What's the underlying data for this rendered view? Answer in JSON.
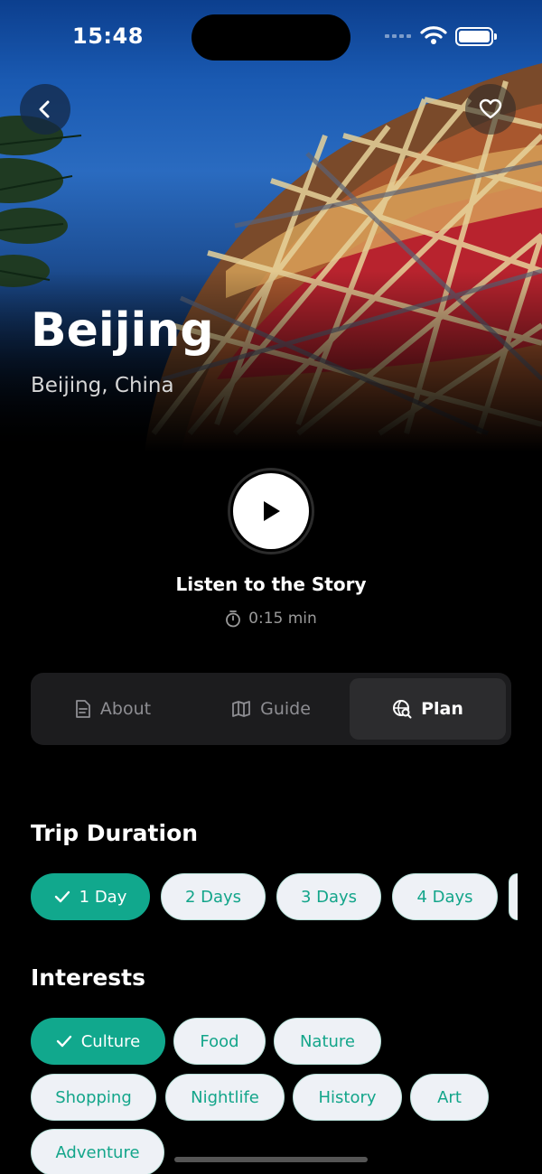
{
  "status_bar": {
    "time": "15:48"
  },
  "hero": {
    "title": "Beijing",
    "subtitle": "Beijing, China"
  },
  "player": {
    "label": "Listen to the Story",
    "duration": "0:15 min"
  },
  "tabs": [
    {
      "label": "About",
      "icon": "document-icon",
      "selected": false
    },
    {
      "label": "Guide",
      "icon": "map-icon",
      "selected": false
    },
    {
      "label": "Plan",
      "icon": "globe-search-icon",
      "selected": true
    }
  ],
  "trip_duration": {
    "title": "Trip Duration",
    "options": [
      {
        "label": "1 Day",
        "selected": true
      },
      {
        "label": "2 Days",
        "selected": false
      },
      {
        "label": "3 Days",
        "selected": false
      },
      {
        "label": "4 Days",
        "selected": false
      }
    ]
  },
  "interests": {
    "title": "Interests",
    "options": [
      {
        "label": "Culture",
        "selected": true
      },
      {
        "label": "Food",
        "selected": false
      },
      {
        "label": "Nature",
        "selected": false
      },
      {
        "label": "Shopping",
        "selected": false
      },
      {
        "label": "Nightlife",
        "selected": false
      },
      {
        "label": "History",
        "selected": false
      },
      {
        "label": "Art",
        "selected": false
      },
      {
        "label": "Adventure",
        "selected": false
      }
    ]
  },
  "colors": {
    "accent": "#11a88d",
    "chip_bg": "#eef1f6",
    "tab_bg": "#1c1c1e",
    "tab_selected_bg": "#2c2c2e"
  }
}
